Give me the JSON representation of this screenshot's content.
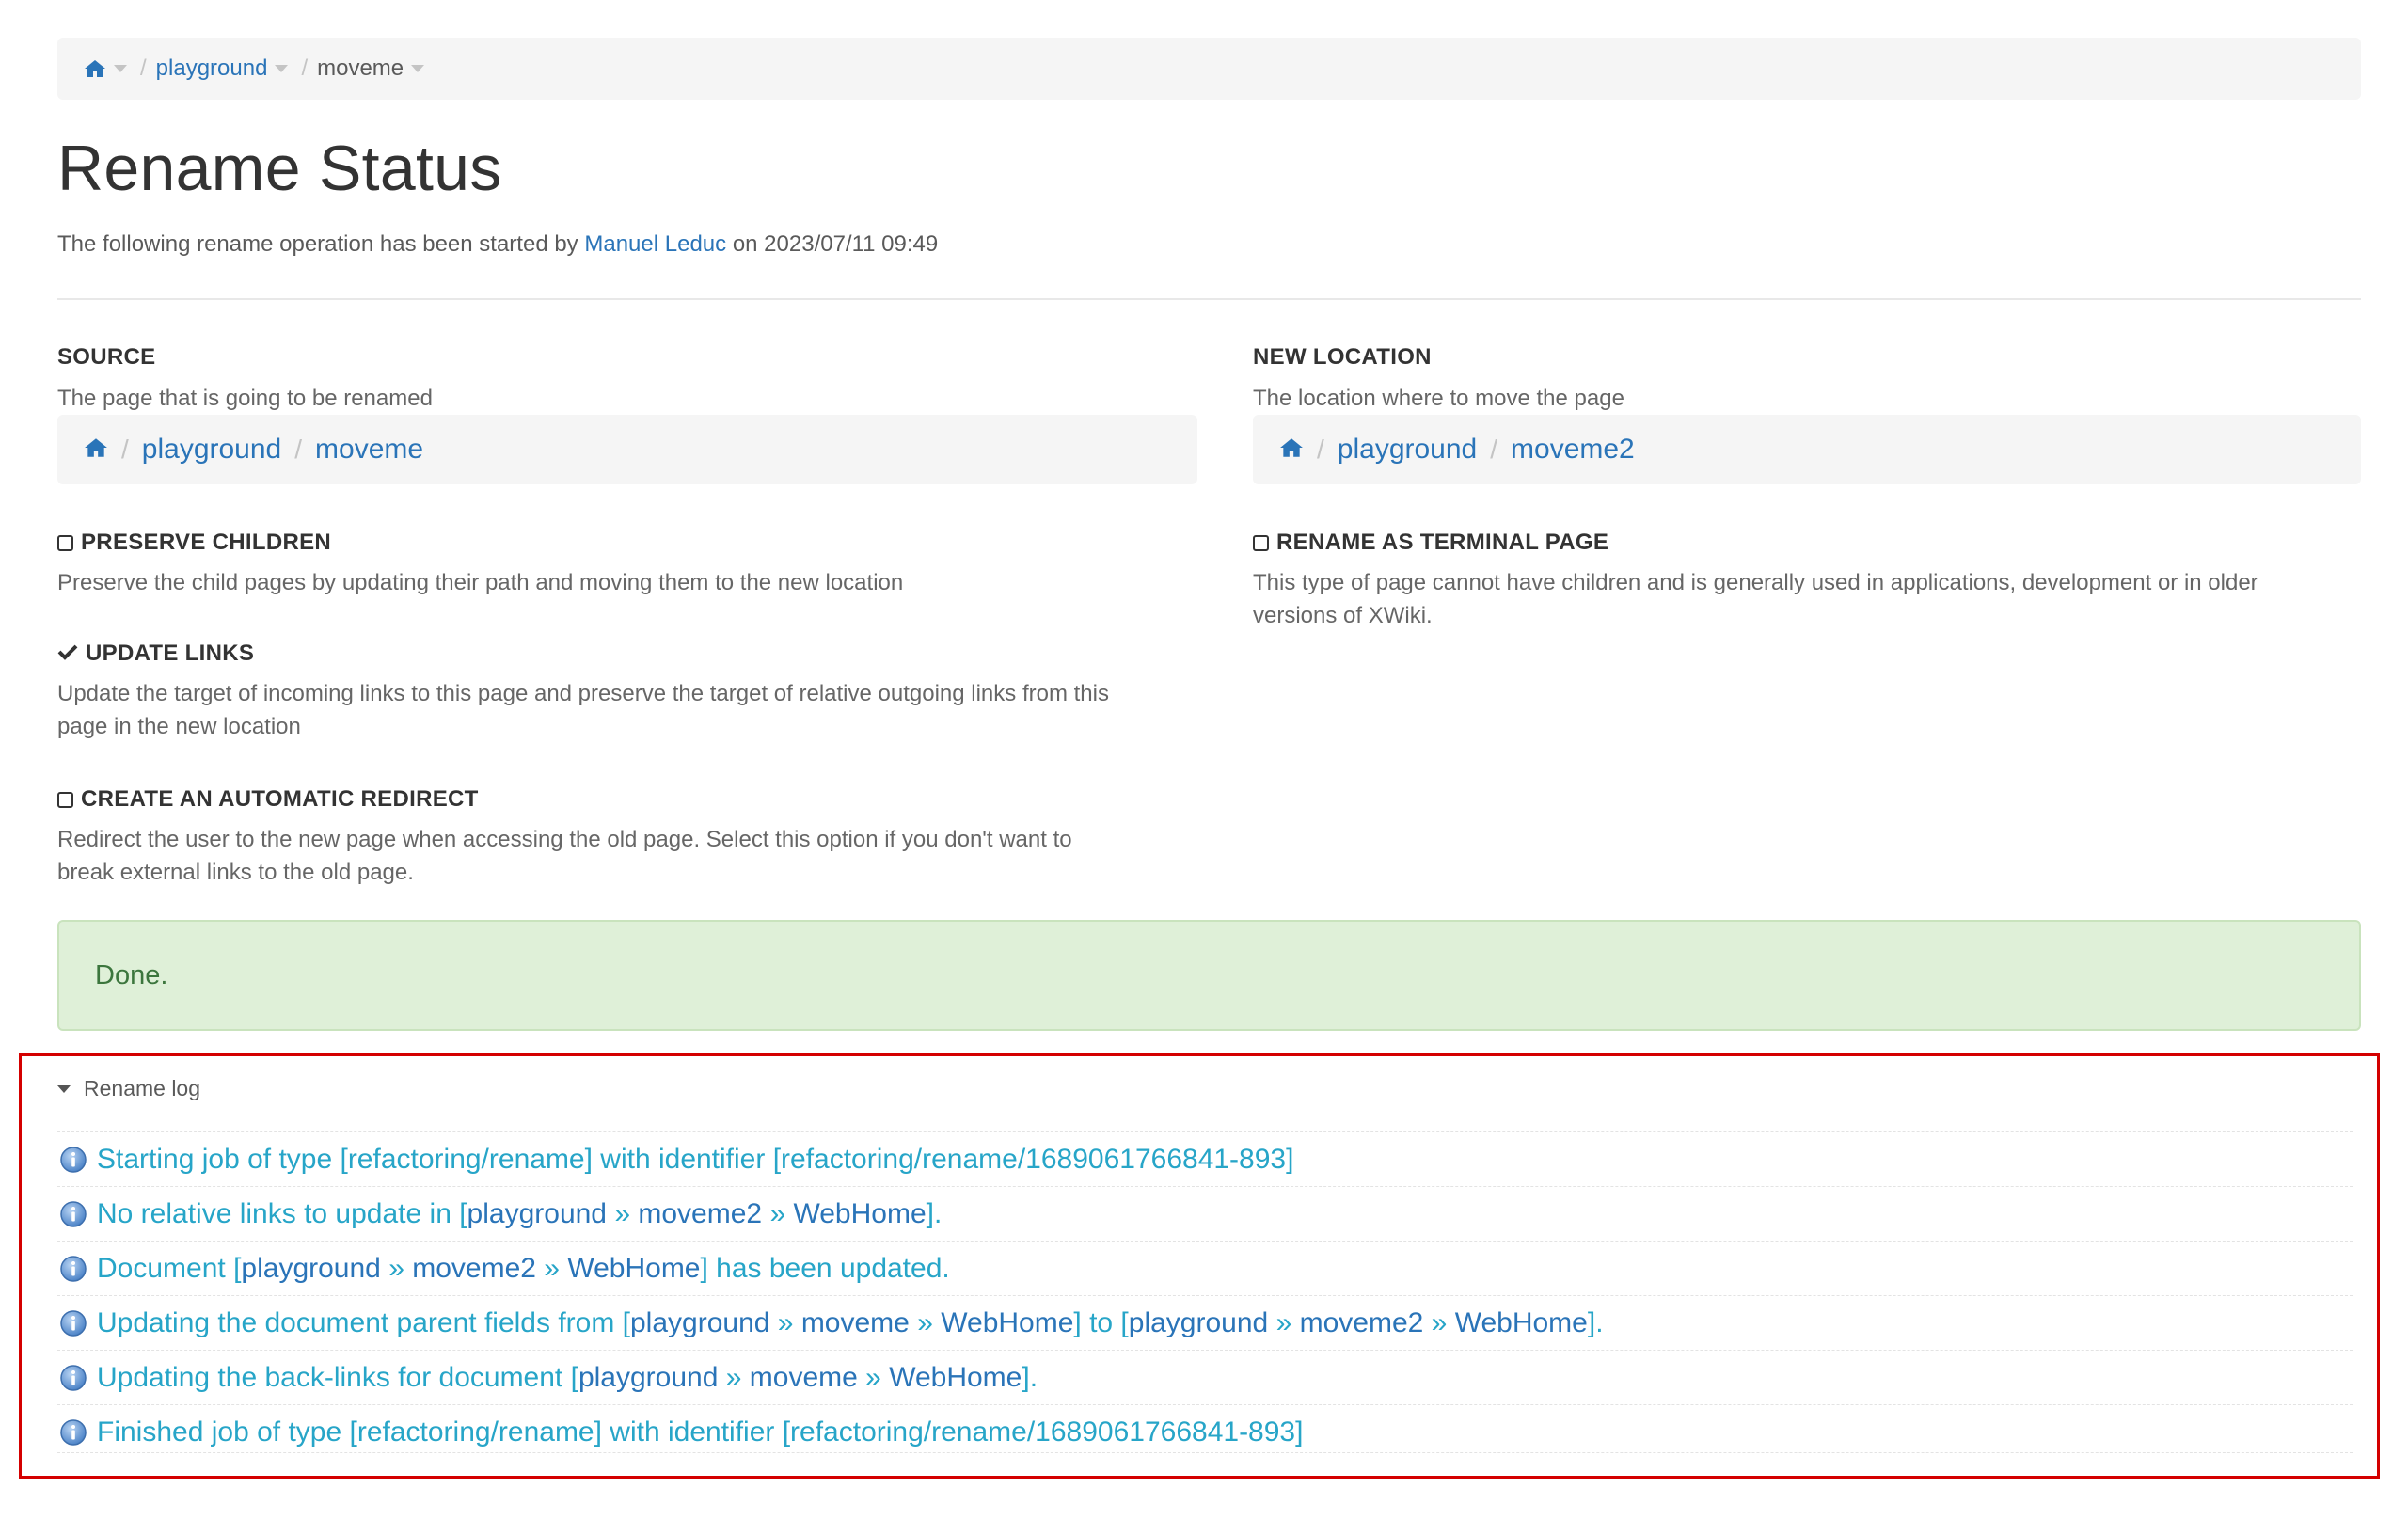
{
  "breadcrumb": {
    "items": [
      "playground",
      "moveme"
    ]
  },
  "page": {
    "title": "Rename Status",
    "subtitle_prefix": "The following rename operation has been started by",
    "user": "Manuel Leduc",
    "subtitle_suffix": "on 2023/07/11 09:49"
  },
  "source": {
    "heading": "SOURCE",
    "description": "The page that is going to be renamed",
    "path": [
      "playground",
      "moveme"
    ]
  },
  "new_location": {
    "heading": "NEW LOCATION",
    "description": "The location where to move the page",
    "path": [
      "playground",
      "moveme2"
    ]
  },
  "options": {
    "preserve_children": {
      "label": "PRESERVE CHILDREN",
      "checked": false,
      "description": "Preserve the child pages by updating their path and moving them to the new location"
    },
    "update_links": {
      "label": "UPDATE LINKS",
      "checked": true,
      "description_line1": "Update the target of incoming links to this page and preserve the target of relative outgoing links from this",
      "description_line2": "page in the new location"
    },
    "create_redirect": {
      "label": "CREATE AN AUTOMATIC REDIRECT",
      "checked": false,
      "description_line1": "Redirect the user to the new page when accessing the old page. Select this option if you don't want to",
      "description_line2": "break external links to the old page."
    },
    "terminal_page": {
      "label": "RENAME AS TERMINAL PAGE",
      "checked": false,
      "description_line1": "This type of page cannot have children and is generally used in applications, development or in older",
      "description_line2": "versions of XWiki."
    }
  },
  "status": {
    "message": "Done."
  },
  "log": {
    "toggle_label": "Rename log",
    "line1": "Starting job of type [refactoring/rename] with identifier [refactoring/rename/1689061766841-893]",
    "line2_prefix": "No relative links to update in [",
    "line2_suffix": "].",
    "line3_prefix": "Document [",
    "line3_suffix": "] has been updated.",
    "line4_prefix": "Updating the document parent fields from [",
    "line4_middle": "] to [",
    "line4_suffix": "].",
    "line5_prefix": "Updating the back-links for document [",
    "line5_suffix": "].",
    "line6": "Finished job of type [refactoring/rename] with identifier [refactoring/rename/1689061766841-893]",
    "ref_playground": "playground",
    "ref_moveme": "moveme",
    "ref_moveme2": "moveme2",
    "ref_webhome": "WebHome",
    "ref_sep": "»"
  },
  "colors": {
    "link": "#2a74b8",
    "log_text": "#27a5c8",
    "success_bg": "#dff0d8",
    "success_text": "#3c763d",
    "highlight_border": "#d40000"
  }
}
